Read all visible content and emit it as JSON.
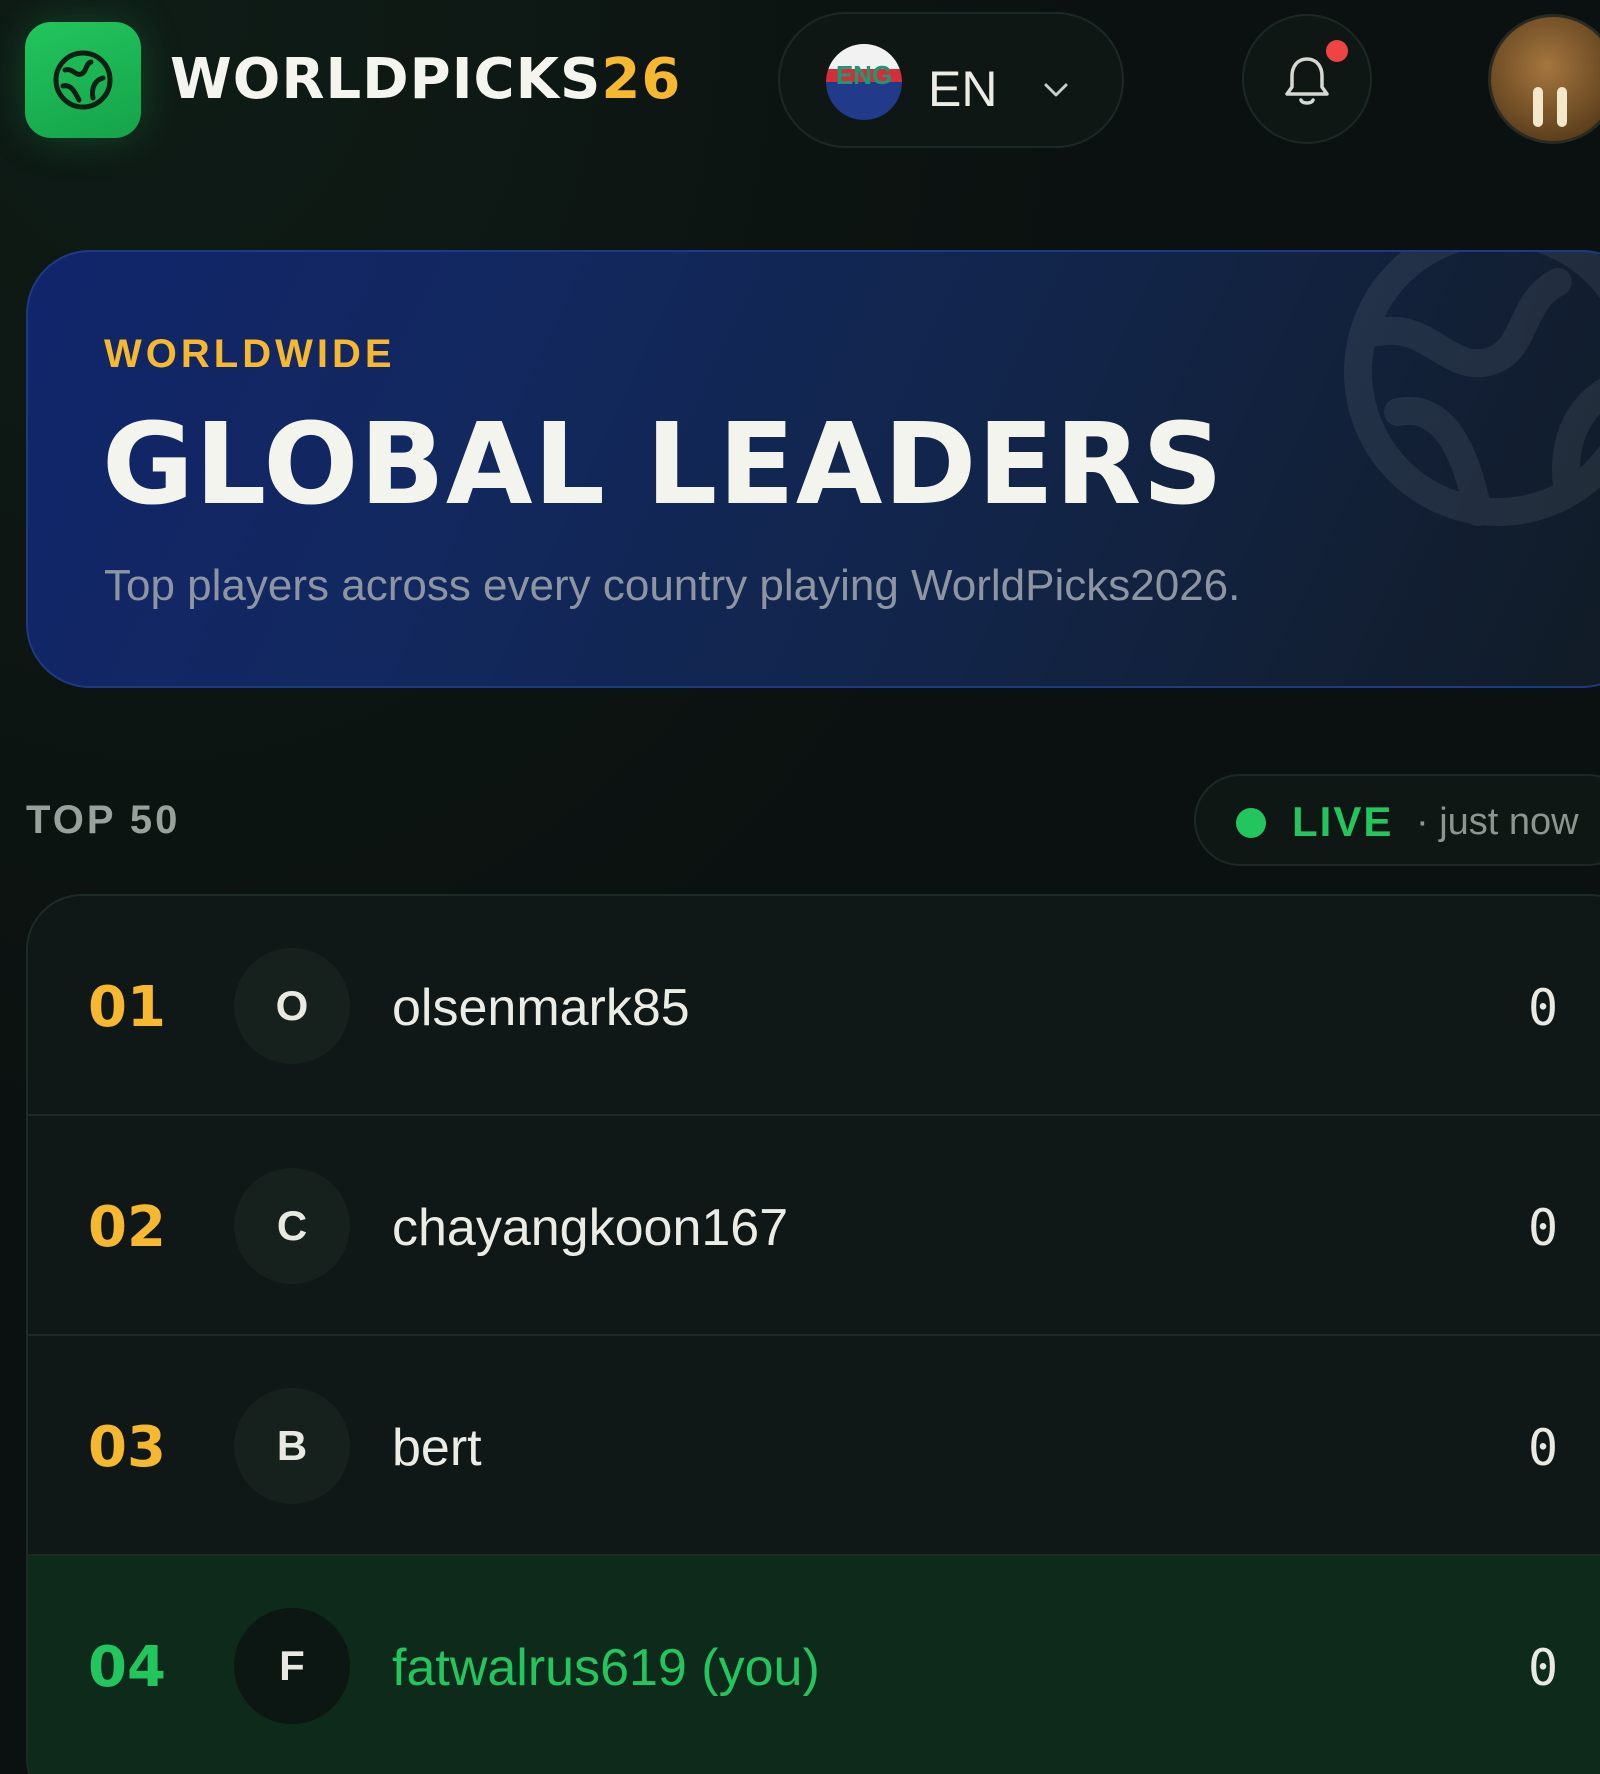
{
  "header": {
    "brand_main": "WORLDPICKS",
    "brand_accent": "26",
    "language": {
      "flag_text": "ENG",
      "code": "EN"
    },
    "notifications": {
      "has_unread": true
    }
  },
  "hero": {
    "kicker": "WORLDWIDE",
    "title": "GLOBAL LEADERS",
    "subtitle": "Top players across every country playing WorldPicks2026."
  },
  "leaderboard": {
    "section_label": "TOP 50",
    "live_label": "LIVE",
    "updated": "· just now",
    "rows": [
      {
        "rank": "01",
        "initial": "O",
        "username": "olsenmark85",
        "score": "0",
        "is_you": false
      },
      {
        "rank": "02",
        "initial": "C",
        "username": "chayangkoon167",
        "score": "0",
        "is_you": false
      },
      {
        "rank": "03",
        "initial": "B",
        "username": "bert",
        "score": "0",
        "is_you": false
      },
      {
        "rank": "04",
        "initial": "F",
        "username": "fatwalrus619 (you)",
        "score": "0",
        "is_you": true
      }
    ]
  },
  "colors": {
    "accent_gold": "#f5b82e",
    "accent_green": "#22c55e",
    "notification_red": "#ef4444",
    "background": "#0b1110"
  },
  "icons": [
    "globe-logo-icon",
    "chevron-down-icon",
    "bell-icon",
    "globe-watermark-icon"
  ]
}
